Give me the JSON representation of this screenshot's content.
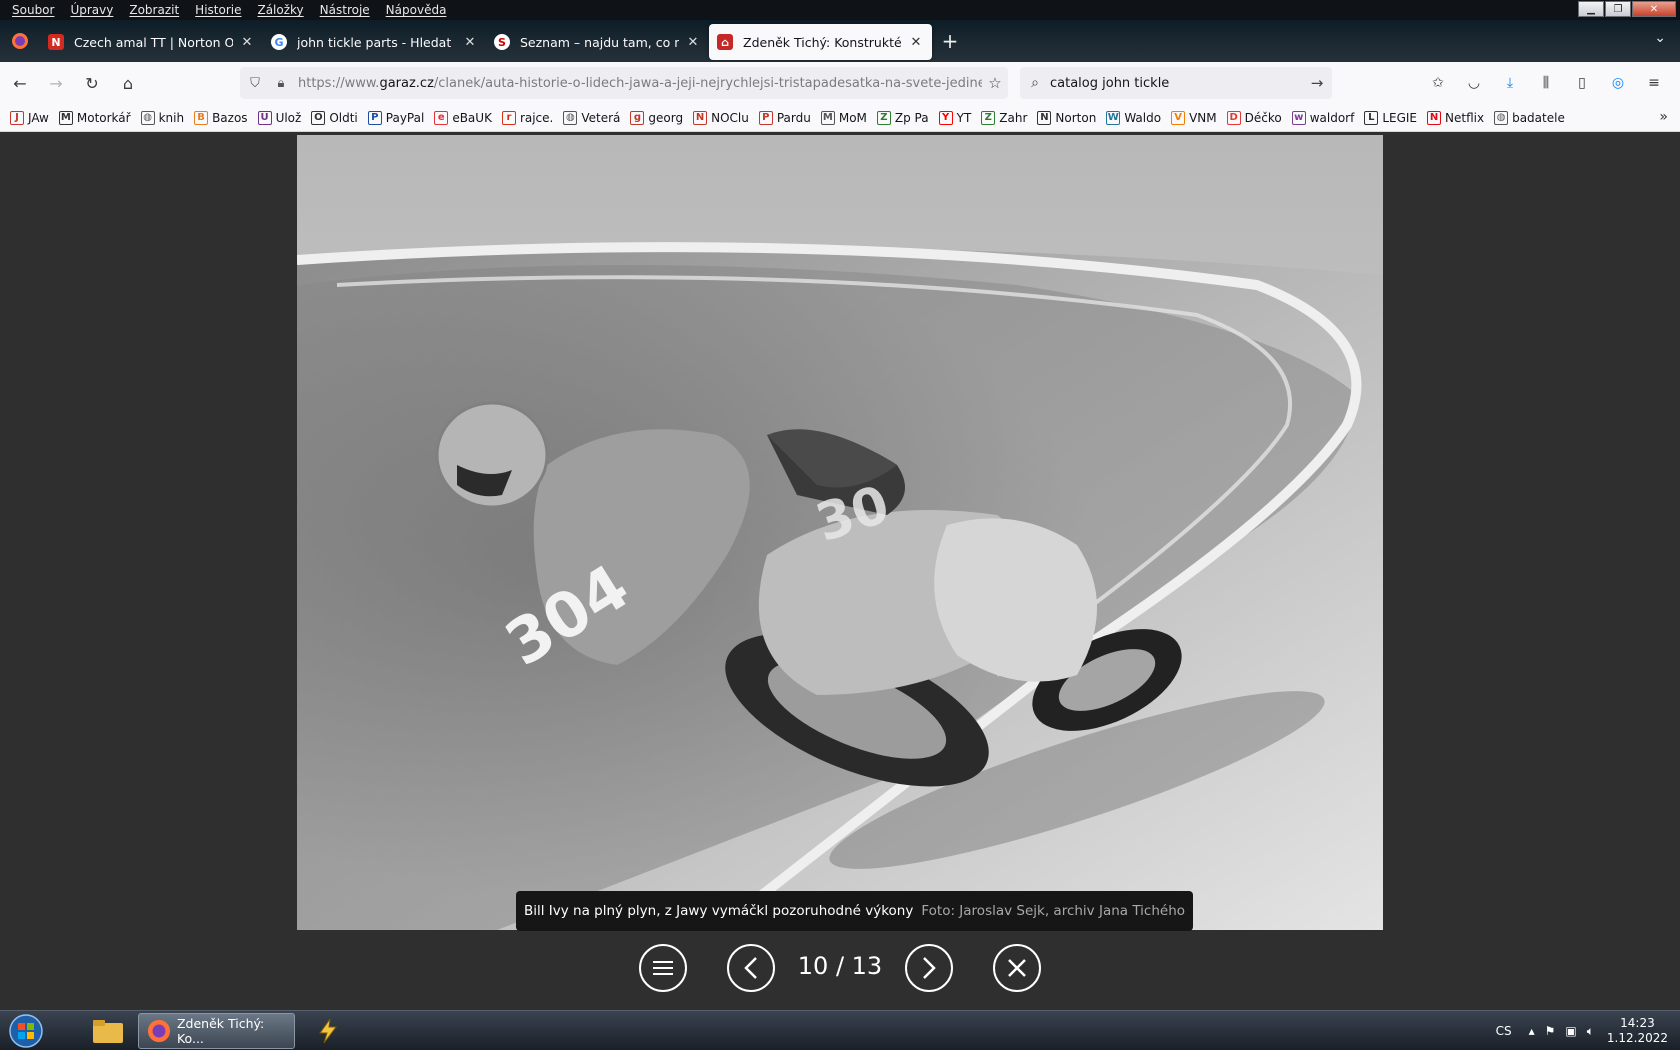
{
  "menubar": {
    "items": [
      "Soubor",
      "Úpravy",
      "Zobrazit",
      "Historie",
      "Záložky",
      "Nástroje",
      "Nápověda"
    ]
  },
  "tabs": [
    {
      "title": "Czech amal TT | Norton Owners",
      "icon": "norton-icon",
      "active": false
    },
    {
      "title": "john tickle parts - Hledat Googlem",
      "icon": "google-icon",
      "active": false
    },
    {
      "title": "Seznam – najdu tam, co neznám",
      "icon": "seznam-icon",
      "active": false
    },
    {
      "title": "Zdeněk Tichý: Konstruktér bořil",
      "icon": "garaz-icon",
      "active": true
    }
  ],
  "navbar": {
    "url_prefix": "https://www.",
    "url_domain": "garaz.cz",
    "url_path": "/clanek/auta-historie-o-lidech-jawa-a-jeji-nejrychlejsi-tristapadesatka-na-svete-jedinecny-",
    "search_value": "catalog john tickle"
  },
  "bookmarks": [
    {
      "label": "JAw",
      "icon": "jawa-icon",
      "color": "#c0392b"
    },
    {
      "label": "Motorkář",
      "icon": "motorkar-icon",
      "color": "#333333"
    },
    {
      "label": "knih",
      "icon": "globe-icon",
      "color": "#555555"
    },
    {
      "label": "Bazos",
      "icon": "bazos-icon",
      "color": "#e67e22"
    },
    {
      "label": "Ulož",
      "icon": "uloz-icon",
      "color": "#6c3483"
    },
    {
      "label": "Oldti",
      "icon": "oldti-icon",
      "color": "#333333"
    },
    {
      "label": "PayPal",
      "icon": "paypal-icon",
      "color": "#1f4e9c"
    },
    {
      "label": "eBaUK",
      "icon": "ebay-icon",
      "color": "#e53238"
    },
    {
      "label": "rajce.",
      "icon": "rajce-icon",
      "color": "#d6301b"
    },
    {
      "label": "Veterá",
      "icon": "globe-icon",
      "color": "#555555"
    },
    {
      "label": "georg",
      "icon": "georg-icon",
      "color": "#c0392b"
    },
    {
      "label": "NOClu",
      "icon": "norton-icon",
      "color": "#c0392b"
    },
    {
      "label": "Pardu",
      "icon": "pardu-icon",
      "color": "#c0392b"
    },
    {
      "label": "MoM",
      "icon": "mom-icon",
      "color": "#555555"
    },
    {
      "label": "Zp Pa",
      "icon": "zppa-icon",
      "color": "#2e7d32"
    },
    {
      "label": "YT",
      "icon": "youtube-icon",
      "color": "#ff0000"
    },
    {
      "label": "Zahr",
      "icon": "zahr-icon",
      "color": "#2e7d32"
    },
    {
      "label": "Norton",
      "icon": "wix-icon",
      "color": "#333333"
    },
    {
      "label": "Waldo",
      "icon": "wordpress-icon",
      "color": "#21759b"
    },
    {
      "label": "VNM",
      "icon": "blogger-icon",
      "color": "#f57d00"
    },
    {
      "label": "Déčko",
      "icon": "decko-icon",
      "color": "#e53935"
    },
    {
      "label": "waldorf",
      "icon": "waldorf-icon",
      "color": "#7b3f8f"
    },
    {
      "label": "LEGIE",
      "icon": "legie-icon",
      "color": "#333333"
    },
    {
      "label": "Netflix",
      "icon": "netflix-icon",
      "color": "#e50914"
    },
    {
      "label": "badatele",
      "icon": "globe-icon",
      "color": "#555555"
    }
  ],
  "viewer": {
    "caption": "Bill Ivy na plný plyn, z Jawy vymáčkl pozoruhodné výkony",
    "credit": "Foto: Jaroslav Sejk, archiv Jana Tichého",
    "counter": "10 / 13",
    "photo_number": "304"
  },
  "taskbar": {
    "active_window": "Zdeněk Tichý: Ko...",
    "language": "CS",
    "time": "14:23",
    "date": "1.12.2022"
  }
}
